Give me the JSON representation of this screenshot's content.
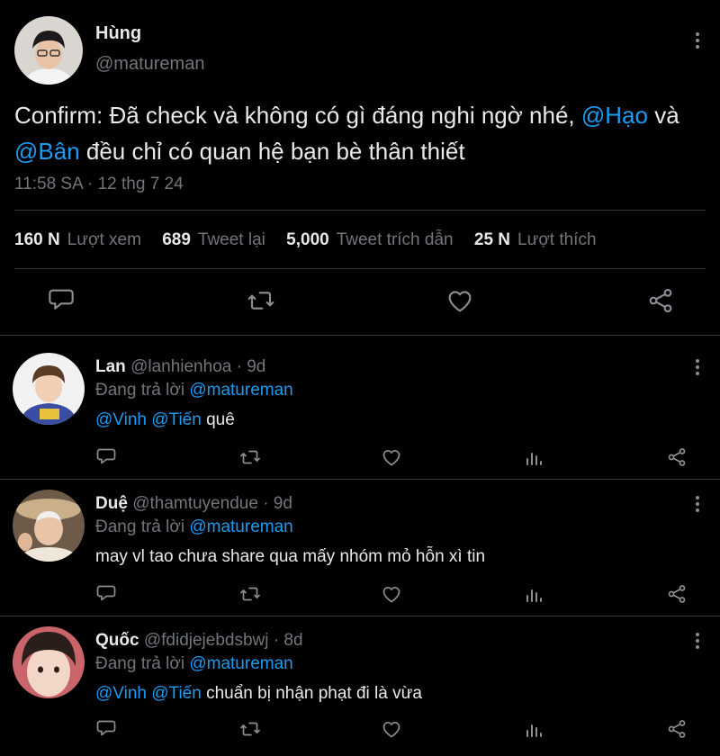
{
  "main_tweet": {
    "name": "Hùng",
    "handle": "@matureman",
    "text_start": "Confirm: Đã check và không có gì đáng nghi ngờ nhé, ",
    "mention_1": "@Hạo",
    "text_mid": " và ",
    "mention_2": "@Bân",
    "text_end": " đều chỉ có quan hệ bạn bè thân thiết",
    "timestamp": "11:58 SA · 12 thg 7 24",
    "stats": [
      {
        "value": "160 N",
        "label": "Lượt xem"
      },
      {
        "value": "689",
        "label": "Tweet lại"
      },
      {
        "value": "5,000",
        "label": "Tweet trích dẫn"
      },
      {
        "value": "25 N",
        "label": "Lượt thích"
      }
    ],
    "actions": [
      "reply-icon",
      "retweet-icon",
      "like-icon",
      "share-icon"
    ]
  },
  "replies": [
    {
      "name": "Lan",
      "handle": "@lanhienhoa",
      "age": "· 9d",
      "replying_prefix": "Đang trả lời ",
      "replying_to": "@matureman",
      "mentions": "@Vinh @Tiến",
      "text": " quê"
    },
    {
      "name": "Duệ",
      "handle": "@thamtuyendue",
      "age": "· 9d",
      "replying_prefix": "Đang trả lời ",
      "replying_to": "@matureman",
      "mentions": "",
      "text": "may vl tao chưa share qua mấy nhóm mỏ hỗn xì tin"
    },
    {
      "name": "Quốc",
      "handle": "@fdidjejebdsbwj",
      "age": "· 8d",
      "replying_prefix": "Đang trả lời ",
      "replying_to": "@matureman",
      "mentions": "@Vinh @Tiến",
      "text": " chuẩn bị nhận phạt đi là vừa"
    }
  ],
  "reply_actions": [
    "reply-icon",
    "retweet-icon",
    "like-icon",
    "analytics-icon",
    "share-icon"
  ],
  "colors": {
    "background": "#000000",
    "text": "#e7e9ea",
    "muted": "#71767b",
    "accent": "#1d9bf0",
    "divider": "#2f3336"
  }
}
